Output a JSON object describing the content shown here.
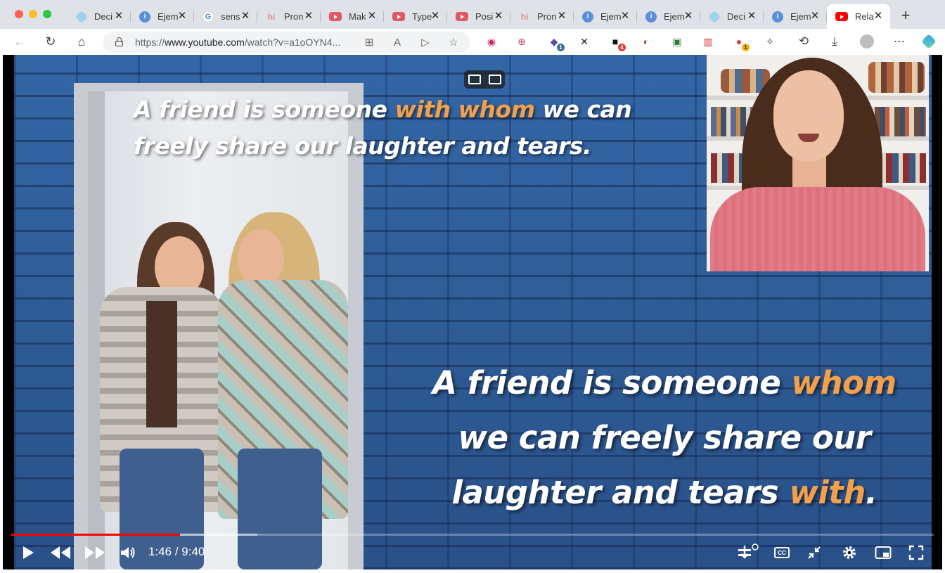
{
  "window": {
    "controls": [
      "close",
      "minimize",
      "maximize"
    ]
  },
  "tabs": [
    {
      "title": "Deci",
      "favicon": "copilot-icon",
      "active": false
    },
    {
      "title": "Ejem",
      "favicon": "info-icon",
      "active": false
    },
    {
      "title": "sens",
      "favicon": "google-icon",
      "active": false
    },
    {
      "title": "Pron",
      "favicon": "hinative-icon",
      "active": false
    },
    {
      "title": "Mak",
      "favicon": "youtube-icon",
      "active": false
    },
    {
      "title": "Type",
      "favicon": "youtube-icon",
      "active": false
    },
    {
      "title": "Posi",
      "favicon": "youtube-icon",
      "active": false
    },
    {
      "title": "Pron",
      "favicon": "hinative-icon",
      "active": false
    },
    {
      "title": "Ejem",
      "favicon": "info-icon",
      "active": false
    },
    {
      "title": "Ejem",
      "favicon": "info-icon",
      "active": false
    },
    {
      "title": "Deci",
      "favicon": "copilot-icon",
      "active": false
    },
    {
      "title": "Ejem",
      "favicon": "info-icon",
      "active": false
    },
    {
      "title": "Rela",
      "favicon": "youtube-icon",
      "active": true
    }
  ],
  "toolbar": {
    "url_prefix": "https://",
    "url_host": "www.youtube.com",
    "url_rest": "/watch?v=a1oOYN4...",
    "extension_badges": [
      "1",
      "4",
      "1"
    ]
  },
  "video": {
    "caption_top_before": "A friend is someone ",
    "caption_top_highlight": "with whom",
    "caption_top_after": " we can freely share our laughter and tears.",
    "caption_main_before": "A friend is someone ",
    "caption_main_highlight1": "whom",
    "caption_main_middle": " we can freely share our laughter and tears ",
    "caption_main_highlight2": "with",
    "caption_main_end": ".",
    "highlight_color": "#f2a04b"
  },
  "player": {
    "current_time": "1:46",
    "separator": " / ",
    "duration": "9:40",
    "progress_played": 0.183,
    "progress_buffered": 0.267,
    "progress_color": "#ff0000"
  }
}
